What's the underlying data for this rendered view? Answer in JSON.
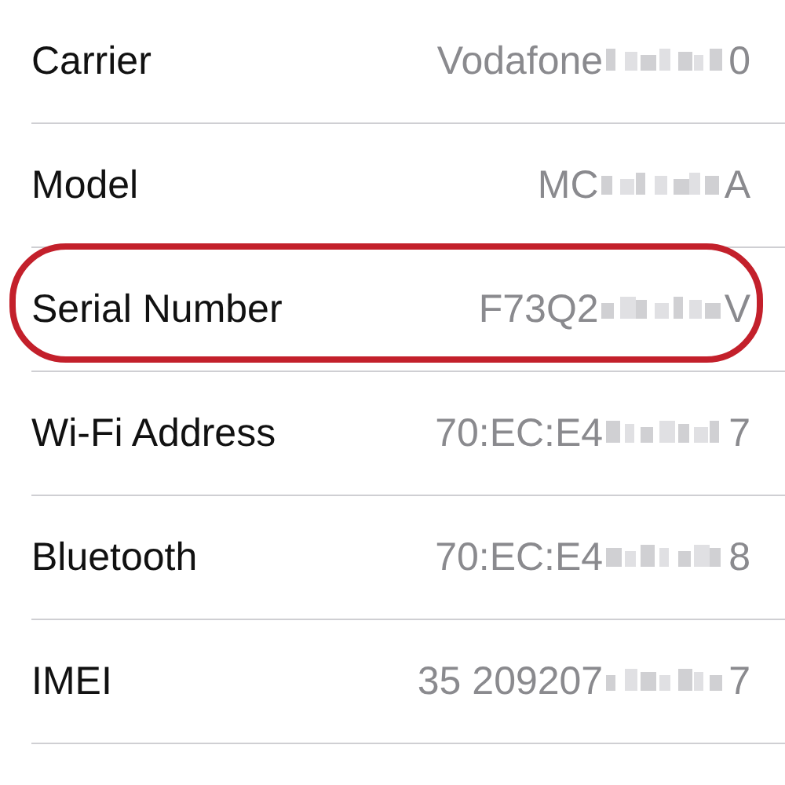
{
  "rows": [
    {
      "label": "Carrier",
      "value_start": "Vodafone",
      "value_end": "0",
      "redacted": true,
      "highlighted": false
    },
    {
      "label": "Model",
      "value_start": "MC",
      "value_end": "A",
      "redacted": true,
      "highlighted": false
    },
    {
      "label": "Serial Number",
      "value_start": "F73Q2",
      "value_end": "V",
      "redacted": true,
      "highlighted": true
    },
    {
      "label": "Wi-Fi Address",
      "value_start": "70:EC:E4",
      "value_end": "7",
      "redacted": true,
      "highlighted": false
    },
    {
      "label": "Bluetooth",
      "value_start": "70:EC:E4",
      "value_end": "8",
      "redacted": true,
      "highlighted": false
    },
    {
      "label": "IMEI",
      "value_start": "35 209207",
      "value_end": "7",
      "redacted": true,
      "highlighted": false
    }
  ]
}
